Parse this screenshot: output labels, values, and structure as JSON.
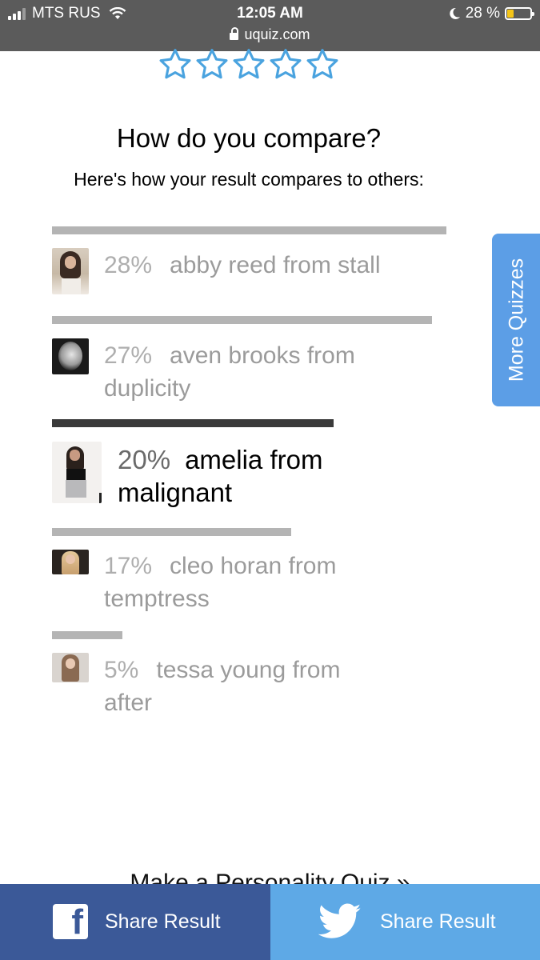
{
  "status": {
    "carrier": "MTS RUS",
    "time": "12:05 AM",
    "battery": "28 %",
    "battery_level": 0.28,
    "url": "uquiz.com"
  },
  "rating": {
    "stars_total": 5,
    "stars_filled": 0,
    "star_color": "#4aa3df"
  },
  "compare": {
    "title": "How do you compare?",
    "subtitle": "Here's how your result compares to others:"
  },
  "results": [
    {
      "pct": "28%",
      "name": "abby reed from stall",
      "value": 28,
      "active": false
    },
    {
      "pct": "27%",
      "name": "aven brooks from duplicity",
      "value": 27,
      "active": false
    },
    {
      "pct": "20%",
      "name": "amelia from malignant",
      "value": 20,
      "active": true
    },
    {
      "pct": "17%",
      "name": "cleo horan from temptress",
      "value": 17,
      "active": false
    },
    {
      "pct": "5%",
      "name": "tessa young from after",
      "value": 5,
      "active": false
    }
  ],
  "more_quizzes": "More Quizzes",
  "make_quiz": "Make a Personality Quiz »",
  "share": {
    "facebook_label": "Share Result",
    "twitter_label": "Share Result",
    "facebook_color": "#3b5998",
    "twitter_color": "#5ea9e6"
  }
}
